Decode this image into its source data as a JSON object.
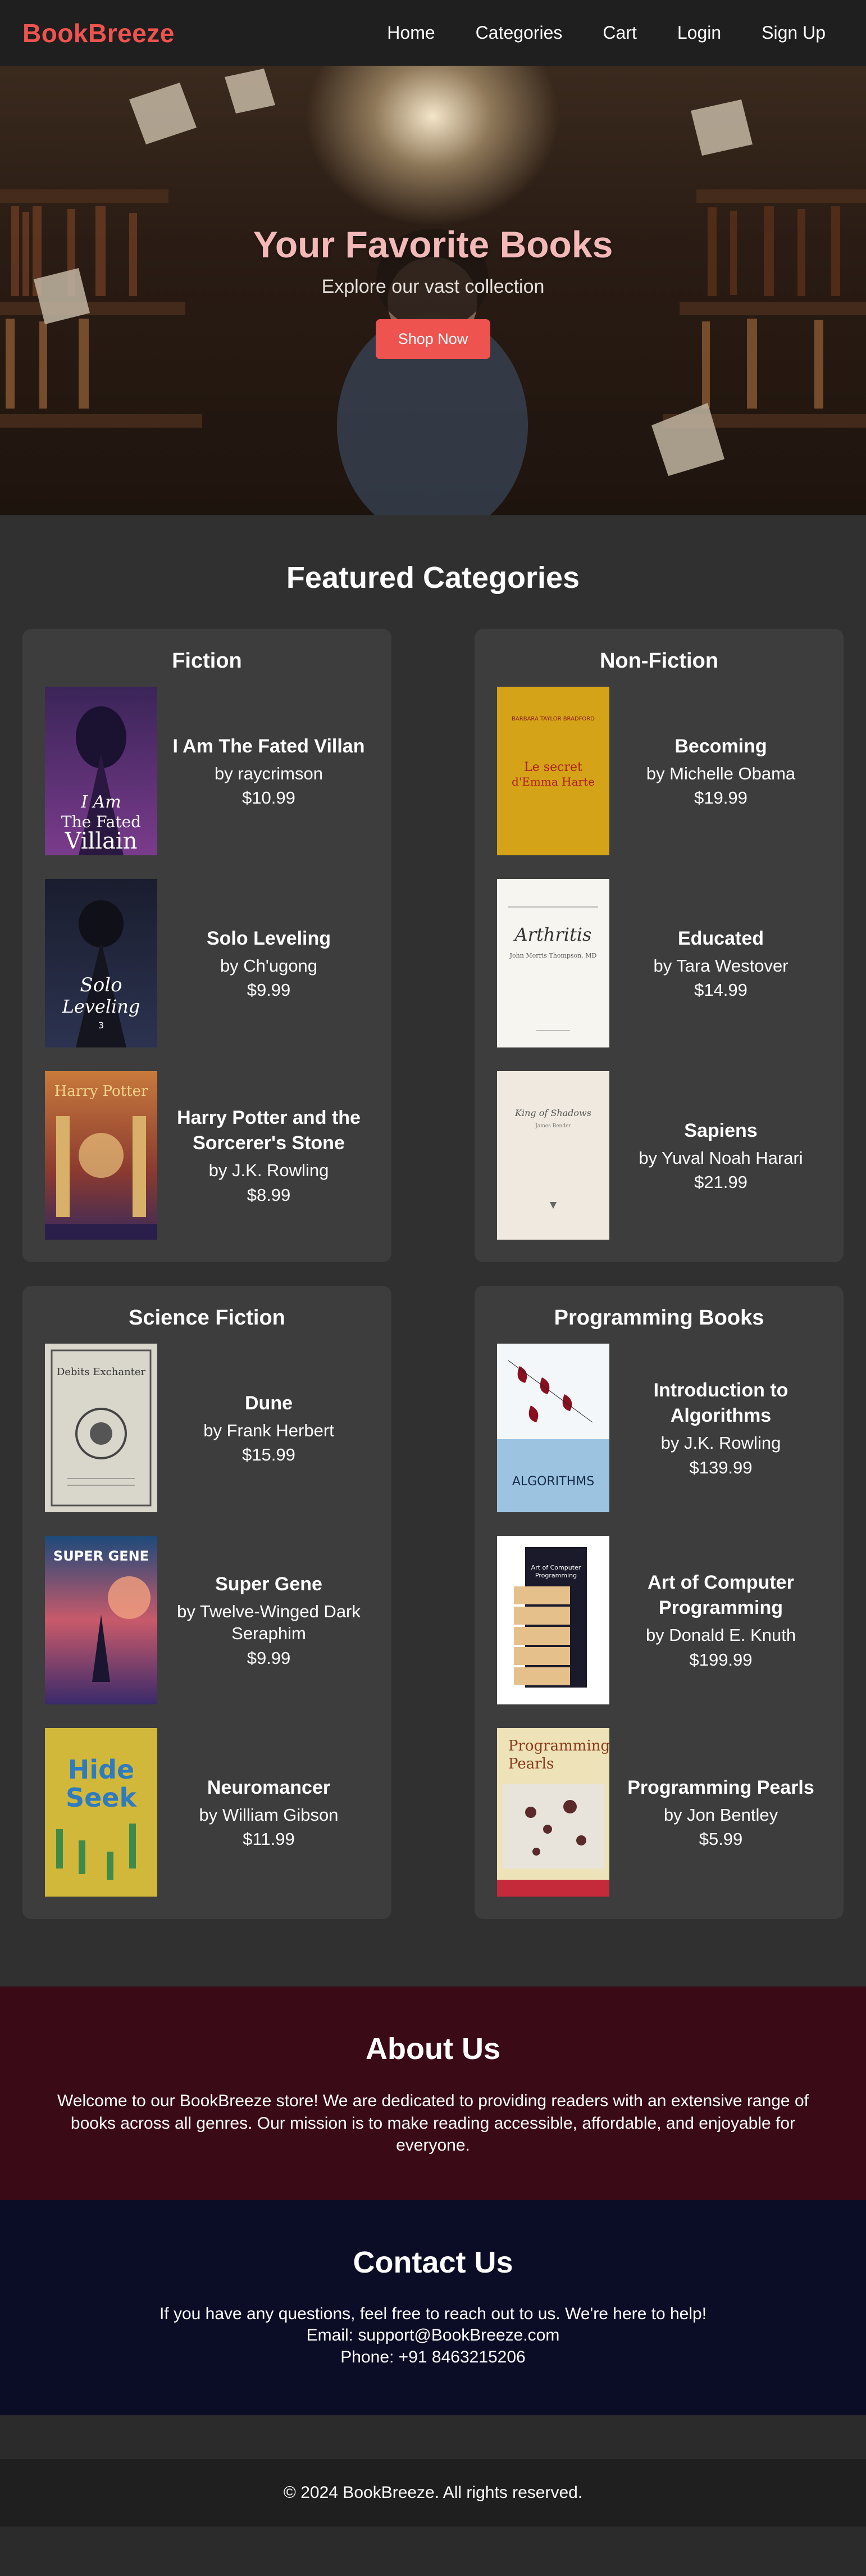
{
  "brand": "BookBreeze",
  "nav": {
    "home": "Home",
    "categories": "Categories",
    "cart": "Cart",
    "login": "Login",
    "signup": "Sign Up"
  },
  "hero": {
    "title": "Your Favorite Books",
    "subtitle": "Explore our vast collection",
    "button": "Shop Now"
  },
  "featured": {
    "title": "Featured Categories",
    "categories": [
      {
        "name": "Fiction",
        "books": [
          {
            "title": "I Am The Fated Villan",
            "author": "by raycrimson",
            "price": "$10.99",
            "cover_text": "I Am The Fated Villain"
          },
          {
            "title": "Solo Leveling",
            "author": "by Ch'ugong",
            "price": "$9.99",
            "cover_text": "Solo Leveling"
          },
          {
            "title": "Harry Potter and the Sorcerer's Stone",
            "author": "by J.K. Rowling",
            "price": "$8.99",
            "cover_text": "Harry Potter"
          }
        ]
      },
      {
        "name": "Non-Fiction",
        "books": [
          {
            "title": "Becoming",
            "author": "by Michelle Obama",
            "price": "$19.99",
            "cover_text": "Le secret d'Emma Harte"
          },
          {
            "title": "Educated",
            "author": "by Tara Westover",
            "price": "$14.99",
            "cover_text": "Arthritis"
          },
          {
            "title": "Sapiens",
            "author": "by Yuval Noah Harari",
            "price": "$21.99",
            "cover_text": "King of Shadows"
          }
        ]
      },
      {
        "name": "Science Fiction",
        "books": [
          {
            "title": "Dune",
            "author": "by Frank Herbert",
            "price": "$15.99",
            "cover_text": "Debits Exchanter"
          },
          {
            "title": "Super Gene",
            "author": "by Twelve-Winged Dark Seraphim",
            "price": "$9.99",
            "cover_text": "SUPER GENE"
          },
          {
            "title": "Neuromancer",
            "author": "by William Gibson",
            "price": "$11.99",
            "cover_text": "Hide Seek"
          }
        ]
      },
      {
        "name": "Programming Books",
        "books": [
          {
            "title": "Introduction to Algorithms",
            "author": "by J.K. Rowling",
            "price": "$139.99",
            "cover_text": "ALGORITHMS"
          },
          {
            "title": "Art of Computer Programming",
            "author": "by Donald E. Knuth",
            "price": "$199.99",
            "cover_text": "Art of Computer Programming"
          },
          {
            "title": "Programming Pearls",
            "author": "by Jon Bentley",
            "price": "$5.99",
            "cover_text": "Programming Pearls"
          }
        ]
      }
    ]
  },
  "about": {
    "title": "About Us",
    "text": "Welcome to our BookBreeze store! We are dedicated to providing readers with an extensive range of books across all genres. Our mission is to make reading accessible, affordable, and enjoyable for everyone."
  },
  "contact": {
    "title": "Contact Us",
    "line1": "If you have any questions, feel free to reach out to us. We're here to help!",
    "line2": "Email: support@BookBreeze.com",
    "line3": "Phone: +91 8463215206"
  },
  "footer": {
    "text": "© 2024 BookBreeze. All rights reserved."
  },
  "colors": {
    "accent": "#ef5350",
    "about_bg": "#3a0b16",
    "contact_bg": "#0b0c26"
  }
}
